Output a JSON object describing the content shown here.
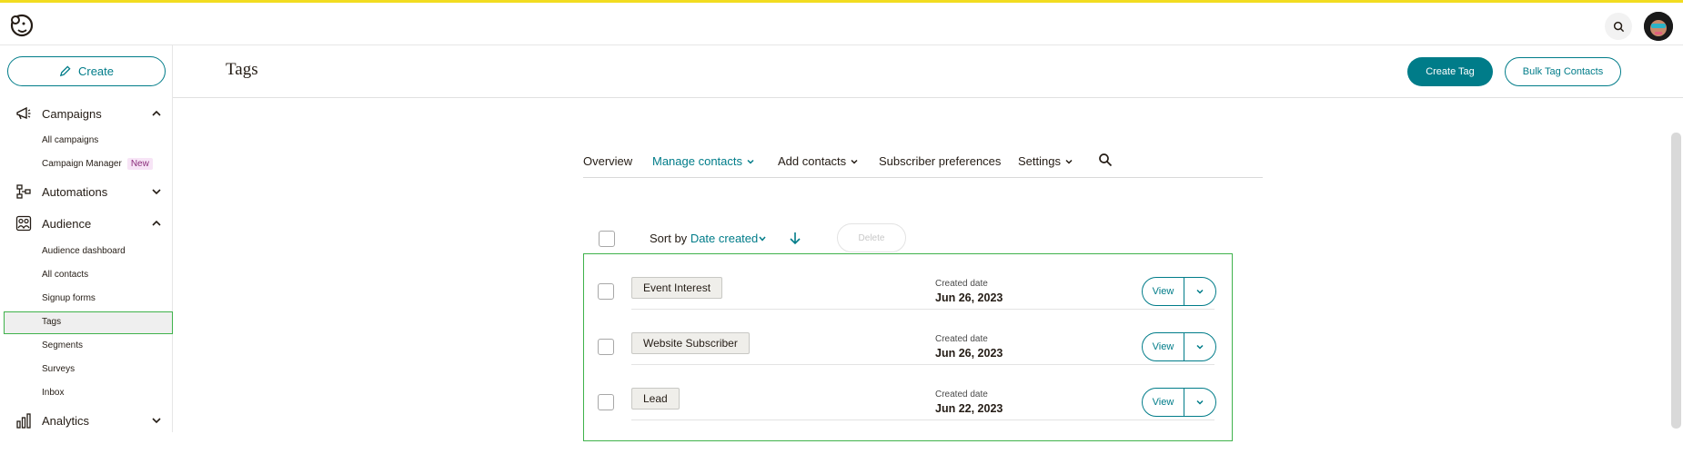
{
  "brand": {
    "accent": "#007c89",
    "highlight": "#3fb24b",
    "topbar_stripe": "#f2dc20"
  },
  "topbar": {
    "logo_icon": "mailchimp-freddie-logo",
    "search_icon": "search-icon",
    "avatar_icon": "user-avatar"
  },
  "sidebar": {
    "create_label": "Create",
    "groups": [
      {
        "label": "Campaigns",
        "icon": "megaphone-icon",
        "expanded": true,
        "items": [
          {
            "label": "All campaigns"
          },
          {
            "label": "Campaign Manager",
            "badge": "New"
          }
        ]
      },
      {
        "label": "Automations",
        "icon": "automation-flow-icon",
        "expanded": false,
        "items": []
      },
      {
        "label": "Audience",
        "icon": "audience-icon",
        "expanded": true,
        "items": [
          {
            "label": "Audience dashboard"
          },
          {
            "label": "All contacts"
          },
          {
            "label": "Signup forms"
          },
          {
            "label": "Tags",
            "active": true
          },
          {
            "label": "Segments"
          },
          {
            "label": "Surveys"
          },
          {
            "label": "Inbox"
          }
        ]
      },
      {
        "label": "Analytics",
        "icon": "bar-chart-icon",
        "expanded": false,
        "items": []
      }
    ]
  },
  "header": {
    "title": "Tags",
    "create_tag_label": "Create Tag",
    "bulk_tag_label": "Bulk Tag Contacts"
  },
  "subnav": {
    "items": [
      {
        "label": "Overview"
      },
      {
        "label": "Manage contacts",
        "dropdown": true,
        "active": true
      },
      {
        "label": "Add contacts",
        "dropdown": true
      },
      {
        "label": "Subscriber preferences"
      },
      {
        "label": "Settings",
        "dropdown": true
      }
    ]
  },
  "toolbar": {
    "sort_prefix": "Sort by",
    "sort_value": "Date created",
    "sort_direction": "descending",
    "delete_label": "Delete"
  },
  "tags": [
    {
      "name": "Event Interest",
      "created_label": "Created date",
      "created_date": "Jun 26, 2023",
      "view_label": "View"
    },
    {
      "name": "Website Subscriber",
      "created_label": "Created date",
      "created_date": "Jun 26, 2023",
      "view_label": "View"
    },
    {
      "name": "Lead",
      "created_label": "Created date",
      "created_date": "Jun 22, 2023",
      "view_label": "View"
    }
  ]
}
